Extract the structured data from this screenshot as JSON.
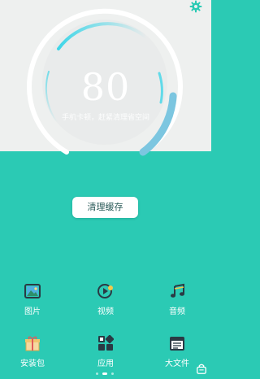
{
  "gauge": {
    "score": "80",
    "hint": "手机卡顿，赶紧清理省空间"
  },
  "actions": {
    "clean_label": "清理缓存"
  },
  "categories": [
    {
      "label": "图片",
      "icon": "image-icon"
    },
    {
      "label": "视频",
      "icon": "video-icon"
    },
    {
      "label": "音频",
      "icon": "music-note-icon"
    },
    {
      "label": "安装包",
      "icon": "gift-box-icon"
    },
    {
      "label": "应用",
      "icon": "app-grid-icon"
    },
    {
      "label": "大文件",
      "icon": "document-icon"
    }
  ],
  "pager": {
    "pages": 3,
    "current": 2
  },
  "colors": {
    "accent": "#2bcab4",
    "top_background": "#eef0ef",
    "arc_blue": "#7cc6e0",
    "arc_cyan": "#3fd6e8"
  }
}
